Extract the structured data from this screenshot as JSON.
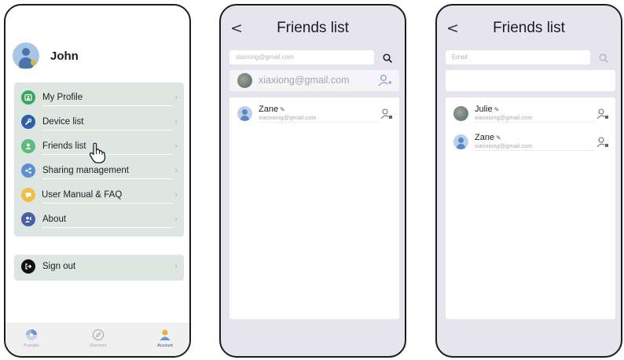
{
  "screen_profile": {
    "user_name": "John",
    "menu_items": [
      {
        "label": "My Profile",
        "icon": "profile-icon",
        "color": "#3aa55e"
      },
      {
        "label": "Device list",
        "icon": "wrench-icon",
        "color": "#2f5fa7"
      },
      {
        "label": "Friends list",
        "icon": "friend-icon",
        "color": "#5dbb7c"
      },
      {
        "label": "Sharing management",
        "icon": "share-icon",
        "color": "#5f8fd2"
      },
      {
        "label": "User Manual & FAQ",
        "icon": "chat-icon",
        "color": "#f0bd45"
      },
      {
        "label": "About",
        "icon": "about-icon",
        "color": "#4960a6"
      }
    ],
    "sign_out": {
      "label": "Sign out",
      "icon": "sign-out-icon",
      "color": "#111111"
    },
    "tabs": [
      {
        "label": "Pumpkit",
        "icon": "pumpkit-icon"
      },
      {
        "label": "Discover",
        "icon": "compass-icon"
      },
      {
        "label": "Account",
        "icon": "account-icon"
      }
    ]
  },
  "screen_search": {
    "back_symbol": "<",
    "title": "Friends list",
    "search_value": "xiaxiong@gmail.com",
    "result_email": "xiaxiong@gmail.com",
    "friends": [
      {
        "name": "Zane",
        "email": "xiaoxiong@gmail.com",
        "avatar": "default"
      }
    ]
  },
  "screen_list": {
    "back_symbol": "<",
    "title": "Friends list",
    "search_placeholder": "Email",
    "friends": [
      {
        "name": "Julie",
        "email": "xiaoxiong@gmail.com",
        "avatar": "photo"
      },
      {
        "name": "Zane",
        "email": "xiaoxiong@gmail.com",
        "avatar": "default"
      }
    ]
  },
  "colors": {
    "menu_card": "#dde6e1",
    "screen_bg": "#e6e4ec",
    "accent_blue": "#5f86bd",
    "account_tab": "#e4b43a"
  }
}
